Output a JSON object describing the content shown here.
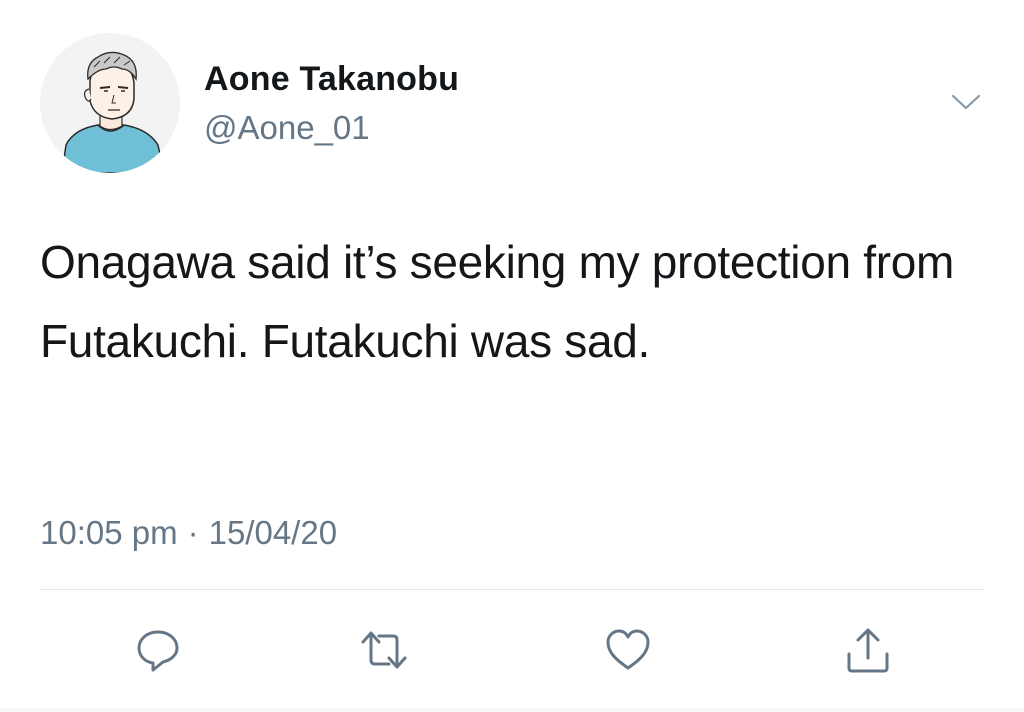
{
  "author": {
    "display_name": "Aone Takanobu",
    "handle": "@Aone_01"
  },
  "tweet": {
    "text": "Onagawa said it’s seeking my protection from Futakuchi. Futakuchi was sad.",
    "time": "10:05 pm",
    "separator": "·",
    "date": "15/04/20"
  },
  "icons": {
    "more": "chevron-down-icon",
    "reply": "reply-icon",
    "retweet": "retweet-icon",
    "like": "heart-icon",
    "share": "share-icon"
  },
  "colors": {
    "text": "#14171a",
    "secondary": "#657786",
    "divider": "#e1e8ed",
    "avatar_shirt": "#6fc0d6"
  }
}
